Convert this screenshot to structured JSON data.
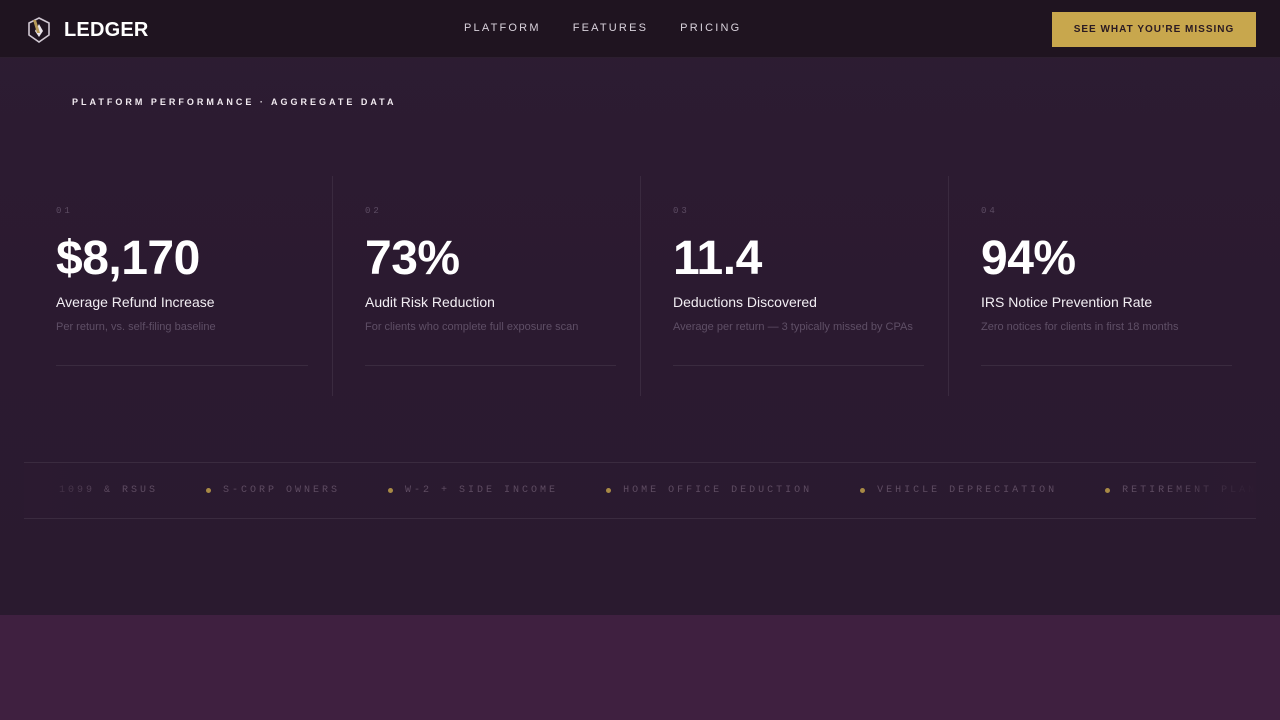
{
  "header": {
    "brand": "LEDGER",
    "brand_icon": "shield-pen-icon",
    "nav": [
      {
        "label": "PLATFORM"
      },
      {
        "label": "FEATURES"
      },
      {
        "label": "PRICING"
      }
    ],
    "cta_label": "SEE WHAT YOU'RE MISSING"
  },
  "hero": {
    "eyebrow": "PLATFORM PERFORMANCE · AGGREGATE DATA"
  },
  "stats": [
    {
      "index": "01",
      "value": "$8,170",
      "label": "Average Refund Increase",
      "note": "Per return, vs. self-filing baseline"
    },
    {
      "index": "02",
      "value": "73%",
      "label": "Audit Risk Reduction",
      "note": "For clients who complete full exposure scan"
    },
    {
      "index": "03",
      "value": "11.4",
      "label": "Deductions Discovered",
      "note": "Average per return — 3 typically missed by CPAs"
    },
    {
      "index": "04",
      "value": "94%",
      "label": "IRS Notice Prevention Rate",
      "note": "Zero notices for clients in first 18 months"
    }
  ],
  "ticker": {
    "items": [
      "1099 & RSUS",
      "S-CORP OWNERS",
      "W-2 + SIDE INCOME",
      "HOME OFFICE DEDUCTION",
      "VEHICLE DEPRECIATION",
      "RETIREMENT PLANNING"
    ]
  },
  "colors": {
    "accent_gold": "#c8a74d",
    "background": "#2a1a2f",
    "header_bg": "#1f1420"
  }
}
